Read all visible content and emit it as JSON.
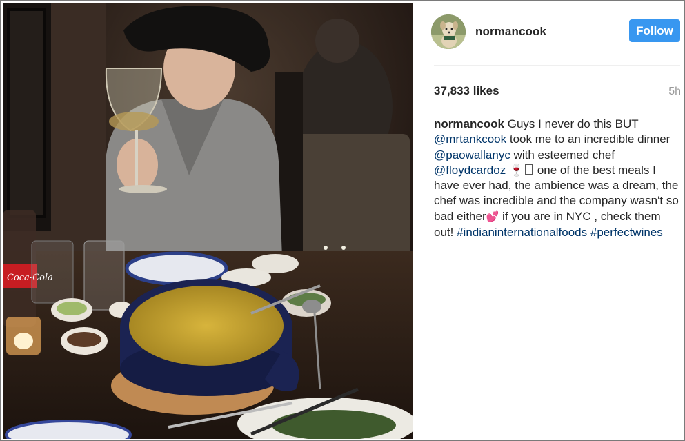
{
  "post": {
    "username": "normancook",
    "follow_label": "Follow",
    "likes": "37,833 likes",
    "time_ago": "5h",
    "caption": {
      "user": "normancook",
      "t1": " Guys I never do this BUT ",
      "m1": "@mrtankcook",
      "t2": " took me to an incredible dinner ",
      "m2": "@paowallanyc",
      "t3": " with esteemed chef ",
      "m3": "@floydcardoz",
      "e1": "🍷",
      "t4": " one of the best meals I have ever had, the ambience was a dream, the chef was incredible and the company wasn't so bad either",
      "e2": "💕",
      "t5": " if you are in NYC , check them out! ",
      "h1": "#indianinternationalfoods",
      "h2": "#perfectwines"
    }
  },
  "photo": {
    "bottle_label": "Coca-Cola"
  },
  "colors": {
    "follow_bg": "#3897f0",
    "link": "#003569",
    "text": "#262626",
    "muted": "#999999"
  },
  "icons": [
    "wine-glass-emoji",
    "hearts-emoji"
  ]
}
